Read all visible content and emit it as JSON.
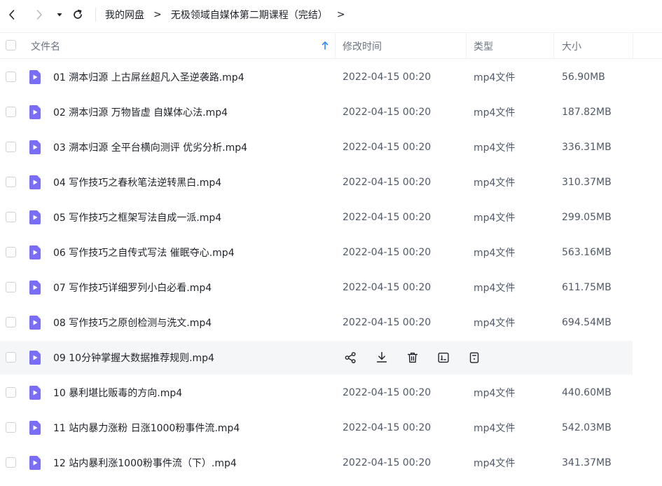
{
  "breadcrumb": {
    "root": "我的网盘",
    "separator": ">",
    "current": "无极领域自媒体第二期课程（完结）",
    "trailing": ">"
  },
  "columns": {
    "name": "文件名",
    "modified": "修改时间",
    "type": "类型",
    "size": "大小"
  },
  "colors": {
    "file_icon": "#7b6ef6",
    "sort_arrow": "#2f88ff",
    "hover_row": "#f5f6f8"
  },
  "icons": {
    "back": "chevron-left-icon",
    "forward": "chevron-right-icon",
    "dropdown": "caret-down-icon",
    "refresh": "refresh-icon",
    "sort": "sort-ascending-icon",
    "file": "video-file-icon",
    "share": "share-icon",
    "download": "download-icon",
    "delete": "trash-icon",
    "rename": "rename-icon",
    "more": "more-icon"
  },
  "files": [
    {
      "name": "01 溯本归源 上古屌丝超凡入圣逆袭路.mp4",
      "date": "2022-04-15 00:20",
      "type": "mp4文件",
      "size": "56.90MB"
    },
    {
      "name": "02 溯本归源 万物皆虚 自媒体心法.mp4",
      "date": "2022-04-15 00:20",
      "type": "mp4文件",
      "size": "187.82MB"
    },
    {
      "name": "03 溯本归源 全平台横向测评 优劣分析.mp4",
      "date": "2022-04-15 00:20",
      "type": "mp4文件",
      "size": "336.31MB"
    },
    {
      "name": "04 写作技巧之春秋笔法逆转黑白.mp4",
      "date": "2022-04-15 00:20",
      "type": "mp4文件",
      "size": "310.37MB"
    },
    {
      "name": "05 写作技巧之框架写法自成一派.mp4",
      "date": "2022-04-15 00:20",
      "type": "mp4文件",
      "size": "299.05MB"
    },
    {
      "name": "06 写作技巧之自传式写法 催眠夺心.mp4",
      "date": "2022-04-15 00:20",
      "type": "mp4文件",
      "size": "563.16MB"
    },
    {
      "name": "07 写作技巧详细罗列小白必看.mp4",
      "date": "2022-04-15 00:20",
      "type": "mp4文件",
      "size": "611.75MB"
    },
    {
      "name": "08 写作技巧之原创检测与洗文.mp4",
      "date": "2022-04-15 00:20",
      "type": "mp4文件",
      "size": "694.54MB"
    },
    {
      "name": "09 10分钟掌握大数据推荐规则.mp4",
      "date": "",
      "type": "",
      "size": ""
    },
    {
      "name": "10 暴利堪比贩毒的方向.mp4",
      "date": "2022-04-15 00:20",
      "type": "mp4文件",
      "size": "440.60MB"
    },
    {
      "name": "11 站内暴力涨粉 日涨1000粉事件流.mp4",
      "date": "2022-04-15 00:20",
      "type": "mp4文件",
      "size": "542.03MB"
    },
    {
      "name": "12 站内暴利涨1000粉事件流（下）.mp4",
      "date": "2022-04-15 00:20",
      "type": "mp4文件",
      "size": "341.37MB"
    }
  ]
}
